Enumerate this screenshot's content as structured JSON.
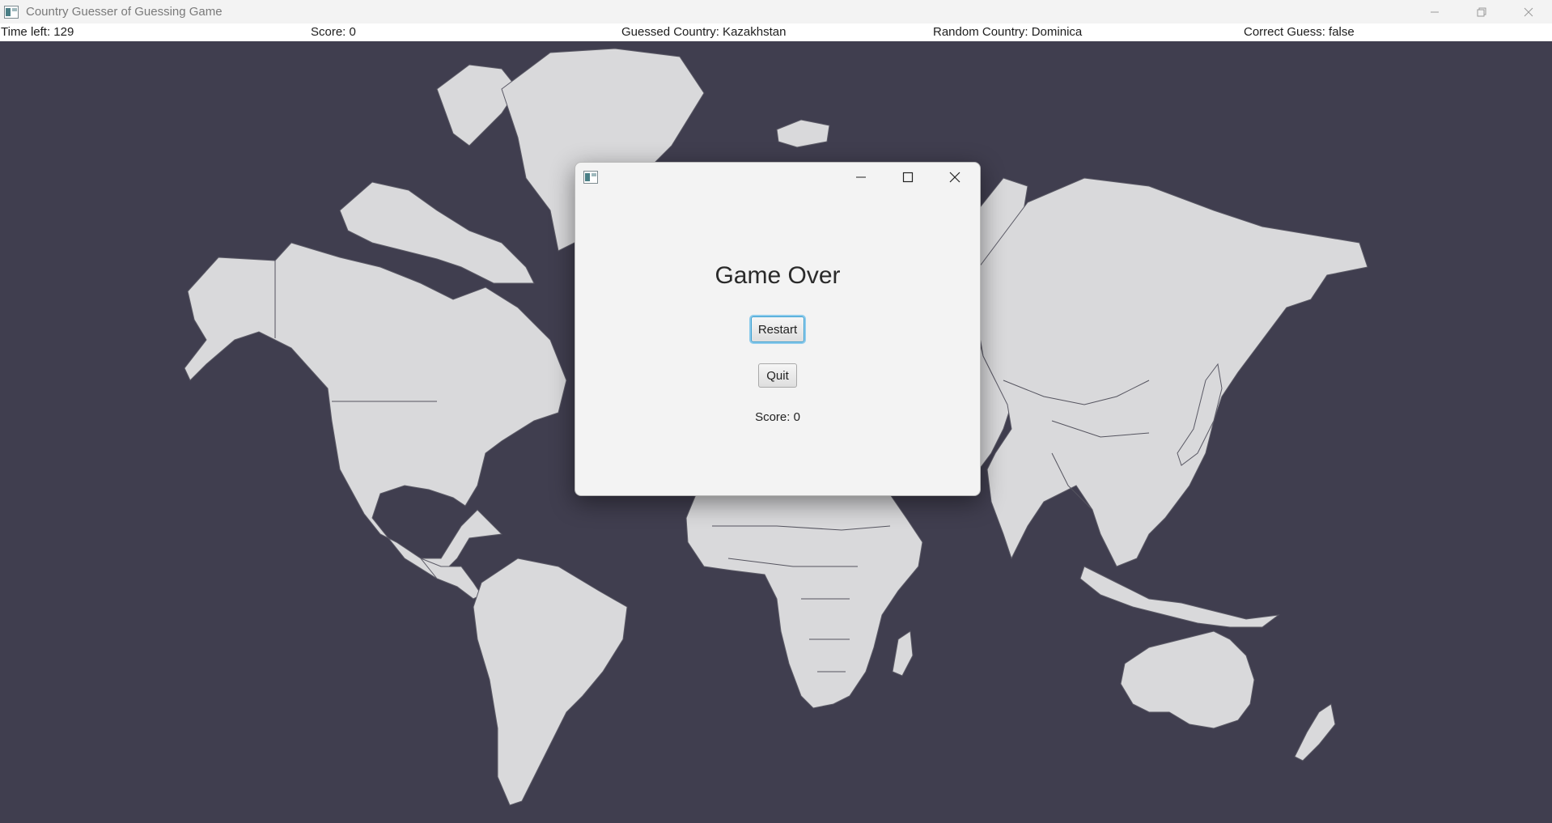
{
  "window": {
    "title": "Country Guesser of Guessing Game",
    "icon": "java-app-icon",
    "controls": [
      "minimize-icon",
      "restore-icon",
      "close-icon"
    ]
  },
  "status": {
    "time_left": "Time left: 129",
    "score": "Score: 0",
    "guessed_country": "Guessed Country: Kazakhstan",
    "random_country": "Random Country: Dominica",
    "correct_guess": "Correct Guess: false"
  },
  "map": {
    "background_color": "#403e4f",
    "land_color": "#d9d9db"
  },
  "dialog": {
    "icon": "java-app-icon",
    "controls": [
      "minimize-icon",
      "maximize-icon",
      "close-icon"
    ],
    "title": "Game Over",
    "restart_label": "Restart",
    "quit_label": "Quit",
    "score_text": "Score: 0"
  }
}
